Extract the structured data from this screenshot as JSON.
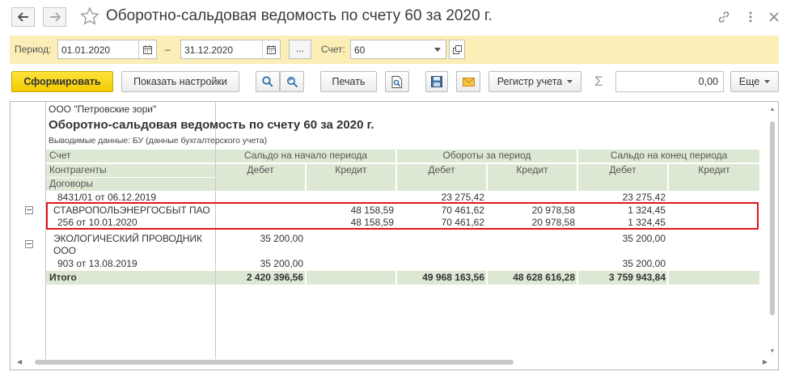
{
  "window": {
    "title": "Оборотно-сальдовая ведомость по счету 60 за 2020 г.",
    "back_icon": "arrow-left-icon",
    "forward_icon": "arrow-right-icon",
    "favorite_icon": "star-icon",
    "link_icon": "link-icon",
    "more_icon": "more-vertical-icon",
    "close_icon": "close-icon"
  },
  "filters": {
    "period_label": "Период:",
    "date_from": "01.01.2020",
    "dash": "–",
    "date_to": "31.12.2020",
    "ellipsis_label": "...",
    "account_label": "Счет:",
    "account_value": "60"
  },
  "toolbar": {
    "generate_label": "Сформировать",
    "settings_label": "Показать настройки",
    "print_label": "Печать",
    "register_label": "Регистр учета",
    "sum_value": "0,00",
    "more_label": "Еще",
    "sigma": "Σ"
  },
  "report": {
    "org": "ООО \"Петровские зори\"",
    "title": "Оборотно-сальдовая ведомость по счету 60 за 2020 г.",
    "subtitle": "Выводимые данные:  БУ (данные бухгалтерского учета)",
    "headers": {
      "account": "Счет",
      "counterparties": "Контрагенты",
      "contracts": "Договоры",
      "opening": "Сальдо на начало периода",
      "turnover": "Обороты за период",
      "closing": "Сальдо на конец периода",
      "debit": "Дебет",
      "credit": "Кредит"
    },
    "rows": [
      {
        "name": "8431/01 от 06.12.2019",
        "open_debit": "",
        "open_credit": "",
        "turn_debit": "23 275,42",
        "turn_credit": "",
        "close_debit": "23 275,42",
        "close_credit": ""
      },
      {
        "name": "СТАВРОПОЛЬЭНЕРГОСБЫТ ПАО",
        "open_debit": "",
        "open_credit": "48 158,59",
        "turn_debit": "70 461,62",
        "turn_credit": "20 978,58",
        "close_debit": "1 324,45",
        "close_credit": ""
      },
      {
        "name": "256 от 10.01.2020",
        "open_debit": "",
        "open_credit": "48 158,59",
        "turn_debit": "70 461,62",
        "turn_credit": "20 978,58",
        "close_debit": "1 324,45",
        "close_credit": ""
      },
      {
        "name_line1": "ЭКОЛОГИЧЕСКИЙ ПРОВОДНИК",
        "name_line2": "ООО",
        "open_debit": "35 200,00",
        "open_credit": "",
        "turn_debit": "",
        "turn_credit": "",
        "close_debit": "35 200,00",
        "close_credit": ""
      },
      {
        "name": "903 от 13.08.2019",
        "open_debit": "35 200,00",
        "open_credit": "",
        "turn_debit": "",
        "turn_credit": "",
        "close_debit": "35 200,00",
        "close_credit": ""
      }
    ],
    "total": {
      "label": "Итого",
      "open_debit": "2 420 396,56",
      "open_credit": "",
      "turn_debit": "49 968 163,56",
      "turn_credit": "48 628 616,28",
      "close_debit": "3 759 943,84",
      "close_credit": ""
    }
  },
  "colors": {
    "filter_bg": "#fbeeb6",
    "primary_button": "#f2c900",
    "table_header_bg": "#dde8d4",
    "highlight_border": "#e0161e"
  }
}
